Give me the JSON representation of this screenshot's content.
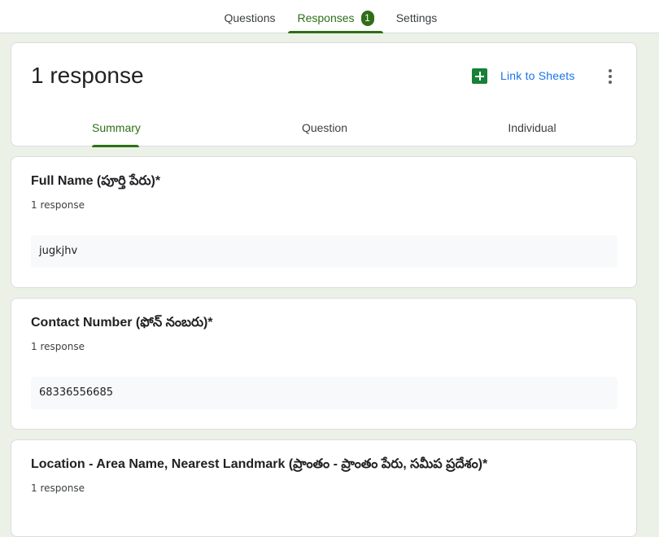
{
  "top_tabs": {
    "questions": "Questions",
    "responses": "Responses",
    "responses_badge": "1",
    "settings": "Settings"
  },
  "summary_header": {
    "title": "1 response",
    "link_to_sheets": "Link to Sheets",
    "sheets_icon": "google-sheets-icon",
    "more_icon": "more-vert-icon"
  },
  "sub_tabs": {
    "summary": "Summary",
    "question": "Question",
    "individual": "Individual"
  },
  "questions": [
    {
      "title": "Full Name (పూర్తి పేరు)*",
      "count": "1 response",
      "answer": "jugkjhv"
    },
    {
      "title": "Contact Number (ఫోన్ నంబరు)*",
      "count": "1 response",
      "answer": "68336556685"
    },
    {
      "title": "Location - Area Name, Nearest Landmark (ప్రాంతం - ప్రాంతం పేరు, సమీప ప్రదేశం)*",
      "count": "1 response"
    }
  ],
  "colors": {
    "accent": "#2e6f17",
    "link": "#1a73e8",
    "background": "#ecf1e7"
  }
}
